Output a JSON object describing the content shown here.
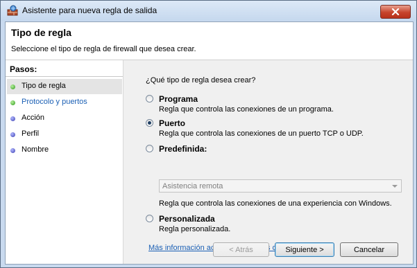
{
  "window": {
    "title": "Asistente para nueva regla de salida",
    "close_icon": "close-icon"
  },
  "header": {
    "title": "Tipo de regla",
    "subtitle": "Seleccione el tipo de regla de firewall que desea crear."
  },
  "steps": {
    "title": "Pasos:",
    "items": [
      {
        "label": "Tipo de regla",
        "status": "green"
      },
      {
        "label": "Protocolo y puertos",
        "status": "green"
      },
      {
        "label": "Acción",
        "status": "blue"
      },
      {
        "label": "Perfil",
        "status": "blue"
      },
      {
        "label": "Nombre",
        "status": "blue"
      }
    ]
  },
  "main": {
    "question": "¿Qué tipo de regla desea crear?",
    "options": [
      {
        "title": "Programa",
        "desc": "Regla que controla las conexiones de un programa.",
        "checked": false
      },
      {
        "title": "Puerto",
        "desc": "Regla que controla las conexiones de un puerto TCP o UDP.",
        "checked": true
      },
      {
        "title": "Predefinida:",
        "desc": "",
        "checked": false
      },
      {
        "title": "Personalizada",
        "desc": "Regla personalizada.",
        "checked": false
      }
    ],
    "predefined_select": "Asistencia remota",
    "predefined_desc": "Regla que controla las conexiones de una experiencia con Windows.",
    "more_info_link": "Más información acerca de los tipos de regla"
  },
  "buttons": {
    "back": "< Atrás",
    "next": "Siguiente >",
    "cancel": "Cancelar"
  }
}
